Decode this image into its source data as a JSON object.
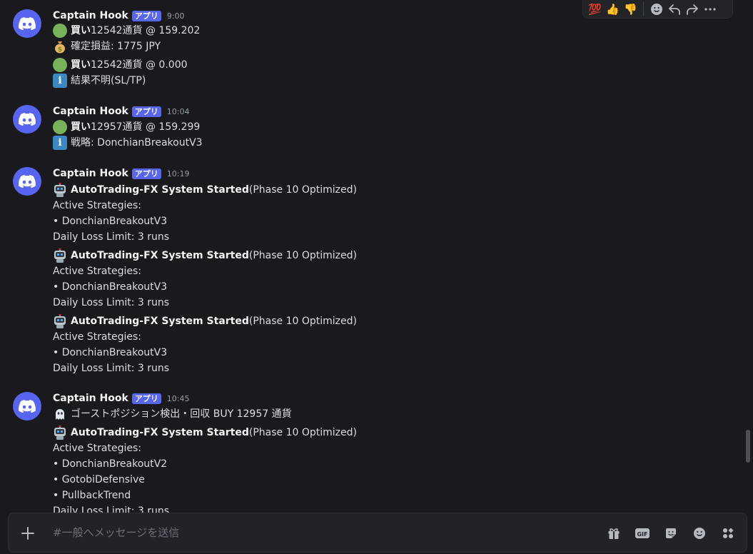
{
  "channel": {
    "input_placeholder": "#一般へメッセージを送信"
  },
  "toolbar": {
    "reactions": [
      "💯",
      "👍",
      "👎"
    ]
  },
  "messages": [
    {
      "author": "Captain Hook",
      "tag": "アプリ",
      "time": "9:00",
      "lines": [
        {
          "icon": "green-circle-icon",
          "bold": "買い",
          "text": " 12542通貨 @ 159.202"
        },
        {
          "icon": "money-bag-icon",
          "bold": "",
          "text": "確定損益: 1775 JPY"
        },
        {
          "icon": "green-circle-icon",
          "bold": "買い",
          "text": " 12542通貨 @ 0.000"
        },
        {
          "icon": "info-icon",
          "bold": "",
          "text": "結果不明(SL/TP)"
        }
      ]
    },
    {
      "author": "Captain Hook",
      "tag": "アプリ",
      "time": "10:04",
      "lines": [
        {
          "icon": "green-circle-icon",
          "bold": "買い",
          "text": " 12957通貨 @ 159.299"
        },
        {
          "icon": "info-icon",
          "bold": "",
          "text": "戦略: DonchianBreakoutV3"
        }
      ]
    },
    {
      "author": "Captain Hook",
      "tag": "アプリ",
      "time": "10:19",
      "lines": [
        {
          "icon": "robot-icon",
          "bold": "AutoTrading-FX System Started",
          "text": " (Phase 10 Optimized)"
        },
        {
          "icon": "",
          "bold": "",
          "text": "Active Strategies:"
        },
        {
          "icon": "",
          "bold": "",
          "text": "• DonchianBreakoutV3"
        },
        {
          "icon": "",
          "bold": "",
          "text": "Daily Loss Limit: 3 runs"
        },
        {
          "icon": "robot-icon",
          "bold": "AutoTrading-FX System Started",
          "text": " (Phase 10 Optimized)"
        },
        {
          "icon": "",
          "bold": "",
          "text": "Active Strategies:"
        },
        {
          "icon": "",
          "bold": "",
          "text": "• DonchianBreakoutV3"
        },
        {
          "icon": "",
          "bold": "",
          "text": "Daily Loss Limit: 3 runs"
        },
        {
          "icon": "robot-icon",
          "bold": "AutoTrading-FX System Started",
          "text": " (Phase 10 Optimized)"
        },
        {
          "icon": "",
          "bold": "",
          "text": "Active Strategies:"
        },
        {
          "icon": "",
          "bold": "",
          "text": "• DonchianBreakoutV3"
        },
        {
          "icon": "",
          "bold": "",
          "text": "Daily Loss Limit: 3 runs"
        }
      ]
    },
    {
      "author": "Captain Hook",
      "tag": "アプリ",
      "time": "10:45",
      "lines": [
        {
          "icon": "ghost-icon",
          "bold": "",
          "text": "ゴーストポジション検出・回収 BUY 12957 通貨"
        },
        {
          "icon": "robot-icon",
          "bold": "AutoTrading-FX System Started",
          "text": " (Phase 10 Optimized)"
        },
        {
          "icon": "",
          "bold": "",
          "text": "Active Strategies:"
        },
        {
          "icon": "",
          "bold": "",
          "text": "• DonchianBreakoutV2"
        },
        {
          "icon": "",
          "bold": "",
          "text": "• GotobiDefensive"
        },
        {
          "icon": "",
          "bold": "",
          "text": "• PullbackTrend"
        },
        {
          "icon": "",
          "bold": "",
          "text": "Daily Loss Limit: 3 runs"
        }
      ]
    }
  ]
}
